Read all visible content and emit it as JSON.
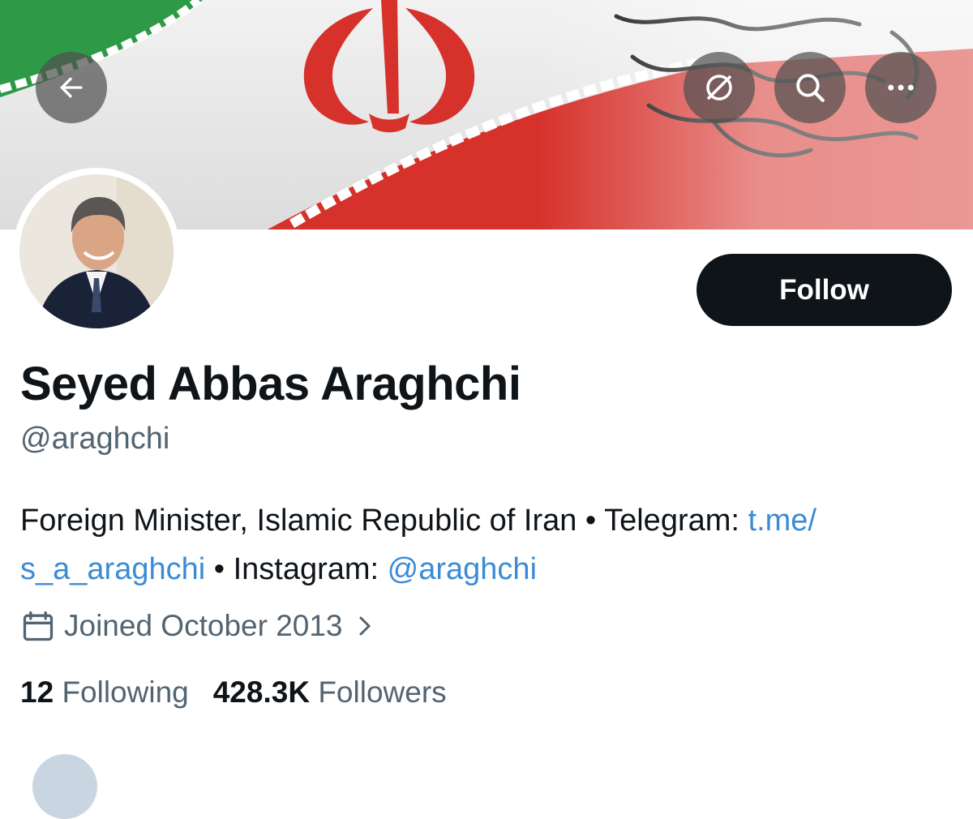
{
  "colors": {
    "text_primary": "#0f1419",
    "text_secondary": "#536471",
    "link": "#3c8bd4",
    "follow_bg": "#0f1419",
    "flag_green": "#2e9a48",
    "flag_red": "#d6312b"
  },
  "banner": {
    "icons": [
      "back-arrow-icon",
      "grok-icon",
      "search-icon",
      "more-icon"
    ]
  },
  "profile": {
    "follow_label": "Follow",
    "name": "Seyed Abbas Araghchi",
    "handle": "@araghchi",
    "bio": {
      "text1": "Foreign Minister, Islamic Republic of Iran • Telegram: ",
      "link1": "t.me/ s_a_araghchi",
      "text2": " • Instagram: ",
      "link2": "@araghchi"
    },
    "joined": "Joined October 2013",
    "following_count": "12",
    "following_label": "Following",
    "followers_count": "428.3K",
    "followers_label": "Followers"
  }
}
